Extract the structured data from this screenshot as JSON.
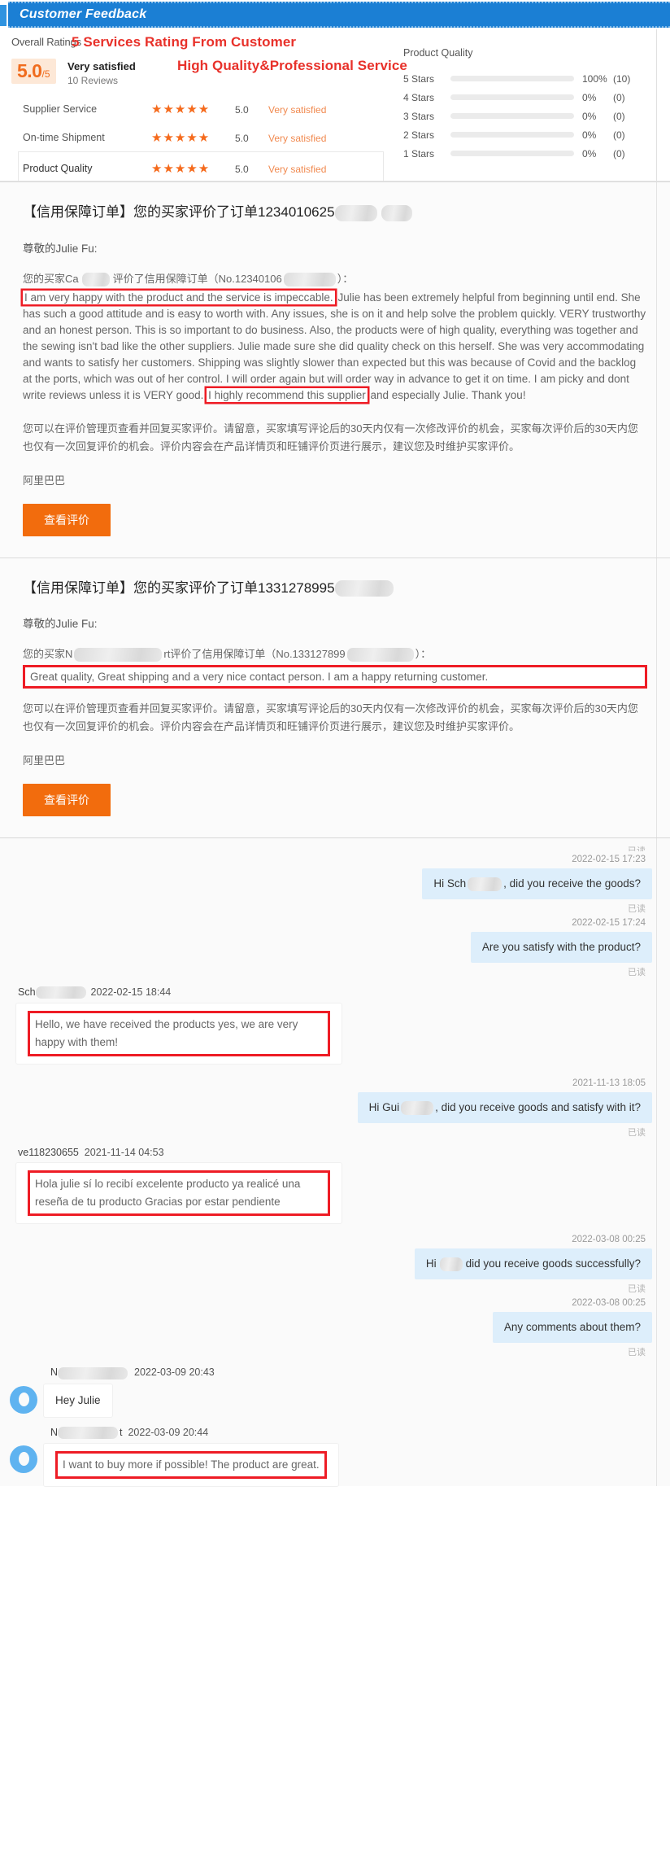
{
  "window": {
    "title": "Customer Feedback"
  },
  "annotations": {
    "line1": "5 Services Rating From Customer",
    "line2": "High Quality&Professional Service"
  },
  "ratings": {
    "overall_label": "Overall Ratings",
    "score": "5.0",
    "score_denominator": "/5",
    "score_desc": "Very satisfied",
    "reviews": "10 Reviews",
    "rows": [
      {
        "name": "Supplier Service",
        "stars": "★★★★★",
        "score": "5.0",
        "desc": "Very satisfied"
      },
      {
        "name": "On-time Shipment",
        "stars": "★★★★★",
        "score": "5.0",
        "desc": "Very satisfied"
      },
      {
        "name": "Product Quality",
        "stars": "★★★★★",
        "score": "5.0",
        "desc": "Very satisfied"
      }
    ]
  },
  "chart_data": {
    "type": "bar",
    "title": "Product Quality",
    "orientation": "horizontal",
    "categories": [
      "5 Stars",
      "4 Stars",
      "3 Stars",
      "2 Stars",
      "1 Stars"
    ],
    "values": [
      100,
      0,
      0,
      0,
      0
    ],
    "counts": [
      10,
      0,
      0,
      0,
      0
    ],
    "percent_labels": [
      "100%",
      "0%",
      "0%",
      "0%",
      "0%"
    ],
    "count_labels": [
      "(10)",
      "(0)",
      "(0)",
      "(0)",
      "(0)"
    ],
    "xlabel": "",
    "ylabel": "",
    "xlim": [
      0,
      100
    ],
    "grid": false,
    "legend": false,
    "bar_color": "#f4701f",
    "track_color": "#ebebeb"
  },
  "colors": {
    "title_bar": "#1b7fd4",
    "accent_orange": "#f26c0d",
    "annotation_red": "#e8312a",
    "highlight_red": "#ee1c25",
    "bubble_out": "#ddeefb",
    "avatar_blue": "#5fb3f0"
  },
  "email1": {
    "title_prefix": "【信用保障订单】您的买家评价了订单1234010625",
    "greeting": "尊敬的Julie Fu:",
    "buyer_line_a": "您的买家Ca",
    "buyer_line_b": "评价了信用保障订单（No.12340106",
    "buyer_line_c": "）：",
    "review_highlight": "I am very happy with the product and the service is impeccable.",
    "review_rest": " Julie has been extremely helpful from beginning until end. She has such a good attitude and is easy to worth with. Any issues, she is on it and help solve the problem quickly. VERY trustworthy and an honest person. This is so important to do business. Also, the products were of high quality, everything was together and the sewing isn't bad like the other suppliers. Julie made sure she did quality check on this herself. She was very accommodating and wants to satisfy her customers. Shipping was slightly slower than expected but this was because of Covid and the backlog at the ports, which was out of her control. I will order again but will order way in advance to get it on time. I am picky and dont write reviews unless it is VERY good. ",
    "review_highlight2": "I highly recommend this supplier",
    "review_tail": " and especially Julie. Thank you!",
    "notice": "您可以在评价管理页查看并回复买家评价。请留意，买家填写评论后的30天内仅有一次修改评价的机会，买家每次评价后的30天内您也仅有一次回复评价的机会。评价内容会在产品详情页和旺铺评价页进行展示，建议您及时维护买家评价。",
    "signature": "阿里巴巴",
    "button": "查看评价"
  },
  "email2": {
    "title_prefix": "【信用保障订单】您的买家评价了订单1331278995",
    "greeting": "尊敬的Julie Fu:",
    "buyer_line_a": "您的买家N",
    "buyer_line_b": "rt评价了信用保障订单（No.133127899",
    "buyer_line_c": "）：",
    "review_highlight": "Great quality, Great shipping and a very nice contact person. I am a happy returning customer.",
    "notice": "您可以在评价管理页查看并回复买家评价。请留意，买家填写评论后的30天内仅有一次修改评价的机会，买家每次评价后的30天内您也仅有一次回复评价的机会。评价内容会在产品详情页和旺铺评价页进行展示，建议您及时维护买家评价。",
    "signature": "阿里巴巴",
    "button": "查看评价"
  },
  "chat": {
    "read_label": "已读",
    "messages": [
      {
        "dir": "out",
        "time": "2022-02-15 17:23",
        "text_a": "Hi Sch",
        "text_b": ", did you receive the goods?",
        "redacted": true,
        "read": "已读"
      },
      {
        "dir": "out",
        "time": "2022-02-15 17:24",
        "text": "Are you satisfy with the product?",
        "read": "已读"
      },
      {
        "dir": "in",
        "sender_prefix": "Sch",
        "sender_time": "2022-02-15 18:44",
        "text": "Hello, we have received the products yes, we are very happy with them!",
        "highlight": true
      },
      {
        "dir": "out",
        "time": "2021-11-13 18:05",
        "text_a": "Hi Gui",
        "text_b": ", did you receive goods and satisfy with it?",
        "redacted": true,
        "read": "已读"
      },
      {
        "dir": "in",
        "sender_prefix": "ve118230655",
        "sender_time": "2021-11-14 04:53",
        "text": "Hola julie sí lo recibí excelente producto ya realicé una reseña de tu producto Gracias por estar pendiente",
        "highlight": true
      },
      {
        "dir": "out",
        "time": "2022-03-08 00:25",
        "text_a": "Hi",
        "text_b": "did you receive goods successfully?",
        "redacted": true,
        "read": "已读"
      },
      {
        "dir": "out",
        "time": "2022-03-08 00:25",
        "text": "Any comments about them?",
        "read": "已读"
      },
      {
        "dir": "in",
        "sender_prefix": "N",
        "sender_time": "2022-03-09 20:43",
        "text": "Hey Julie",
        "avatar": true
      },
      {
        "dir": "in",
        "sender_prefix": "N",
        "sender_suffix": "t",
        "sender_time": "2022-03-09 20:44",
        "text": "I want to buy more if possible! The product are great.",
        "avatar": true,
        "highlight": true
      }
    ]
  }
}
